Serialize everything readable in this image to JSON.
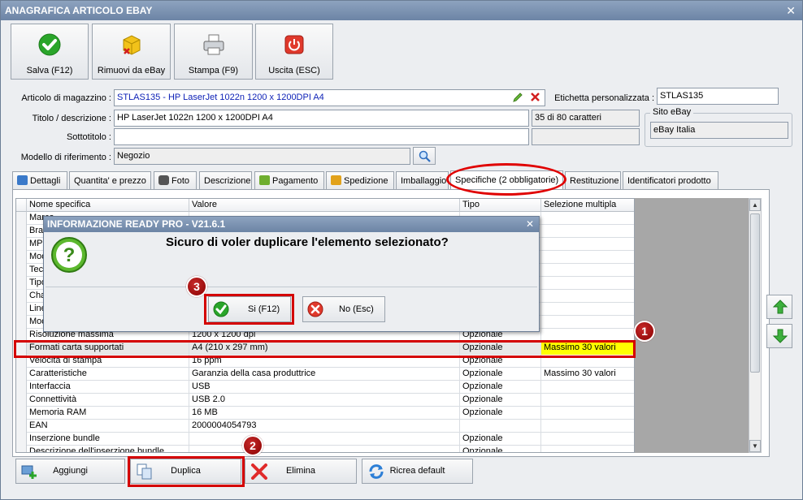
{
  "window": {
    "title": "ANAGRAFICA ARTICOLO EBAY",
    "close": "✕"
  },
  "toolbar": [
    {
      "label": "Salva (F12)",
      "icon": "check-icon"
    },
    {
      "label": "Rimuovi da eBay",
      "icon": "box-remove-icon"
    },
    {
      "label": "Stampa (F9)",
      "icon": "printer-icon"
    },
    {
      "label": "Uscita (ESC)",
      "icon": "power-icon"
    }
  ],
  "form": {
    "articolo_label": "Articolo di magazzino :",
    "articolo_value": "STLAS135 - HP LaserJet 1022n 1200 x 1200DPI A4",
    "etichetta_label": "Etichetta personalizzata :",
    "etichetta_value": "STLAS135",
    "titolo_label": "Titolo / descrizione :",
    "titolo_value": "HP LaserJet 1022n 1200 x 1200DPI A4",
    "titolo_counter": "35 di 80 caratteri",
    "sottotitolo_label": "Sottotitolo :",
    "sottotitolo_value": "",
    "modello_label": "Modello di riferimento :",
    "modello_value": "Negozio",
    "sito_label": "Sito eBay",
    "sito_value": "eBay Italia"
  },
  "tabs": [
    {
      "label": "Dettagli"
    },
    {
      "label": "Quantita' e prezzo"
    },
    {
      "label": "Foto"
    },
    {
      "label": "Descrizione"
    },
    {
      "label": "Pagamento"
    },
    {
      "label": "Spedizione"
    },
    {
      "label": "Imballaggio"
    },
    {
      "label": "Specifiche (2 obbligatorie)"
    },
    {
      "label": "Restituzione"
    },
    {
      "label": "Identificatori prodotto"
    }
  ],
  "grid": {
    "headers": [
      "Nome specifica",
      "Valore",
      "Tipo",
      "Selezione multipla"
    ],
    "rows": [
      [
        "Marca",
        "",
        "",
        ""
      ],
      [
        "Brand",
        "",
        "",
        ""
      ],
      [
        "MPN",
        "",
        "",
        ""
      ],
      [
        "Modello",
        "",
        "",
        ""
      ],
      [
        "Tecnologia",
        "",
        "",
        ""
      ],
      [
        "Tipo",
        "",
        "",
        ""
      ],
      [
        "Characteristics",
        "",
        "",
        ""
      ],
      [
        "Linea",
        "",
        "",
        ""
      ],
      [
        "Modello stampante",
        "",
        "",
        ""
      ],
      [
        "Risoluzione massima",
        "1200 x 1200 dpi",
        "Opzionale",
        ""
      ],
      [
        "Formati carta supportati",
        "A4 (210 x 297 mm)",
        "Opzionale",
        "Massimo 30 valori"
      ],
      [
        "Velocità di stampa",
        "16 ppm",
        "Opzionale",
        ""
      ],
      [
        "Caratteristiche",
        "Garanzia della casa produttrice",
        "Opzionale",
        "Massimo 30 valori"
      ],
      [
        "Interfaccia",
        "USB",
        "Opzionale",
        ""
      ],
      [
        "Connettività",
        "USB 2.0",
        "Opzionale",
        ""
      ],
      [
        "Memoria RAM",
        "16 MB",
        "Opzionale",
        ""
      ],
      [
        "EAN",
        "2000004054793",
        "",
        ""
      ],
      [
        "Inserzione bundle",
        "",
        "Opzionale",
        ""
      ],
      [
        "Descrizione dell'inserzione bundle",
        "",
        "Opzionale",
        ""
      ]
    ]
  },
  "bottom_buttons": [
    {
      "label": "Aggiungi",
      "icon": "add-row-icon"
    },
    {
      "label": "Duplica",
      "icon": "duplicate-icon"
    },
    {
      "label": "Elimina",
      "icon": "delete-icon"
    },
    {
      "label": "Ricrea default",
      "icon": "refresh-icon"
    }
  ],
  "dialog": {
    "title": "INFORMAZIONE READY PRO - V21.6.1",
    "close": "✕",
    "message": "Sicuro di voler duplicare l'elemento selezionato?",
    "yes_label": "Si (F12)",
    "no_label": "No (Esc)"
  },
  "markers": [
    "1",
    "2",
    "3"
  ],
  "colors": {
    "title_bar": "#7990b0",
    "highlight": "#ffff00",
    "annotation": "#d40000"
  }
}
